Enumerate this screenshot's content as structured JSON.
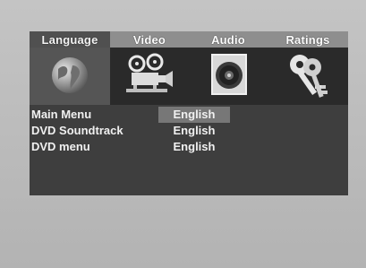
{
  "tabs": [
    {
      "label": "Language"
    },
    {
      "label": "Video"
    },
    {
      "label": "Audio"
    },
    {
      "label": "Ratings"
    }
  ],
  "icons": [
    "globe-icon",
    "film-projector-icon",
    "speaker-icon",
    "keys-icon"
  ],
  "settings": [
    {
      "label": "Main Menu",
      "value": "English"
    },
    {
      "label": "DVD Soundtrack",
      "value": "English"
    },
    {
      "label": "DVD menu",
      "value": "English"
    }
  ],
  "colors": {
    "panel": "#3e3e3e",
    "active_tab": "#505050",
    "inactive_tab": "#8e8e8e",
    "highlight": "#777777"
  }
}
